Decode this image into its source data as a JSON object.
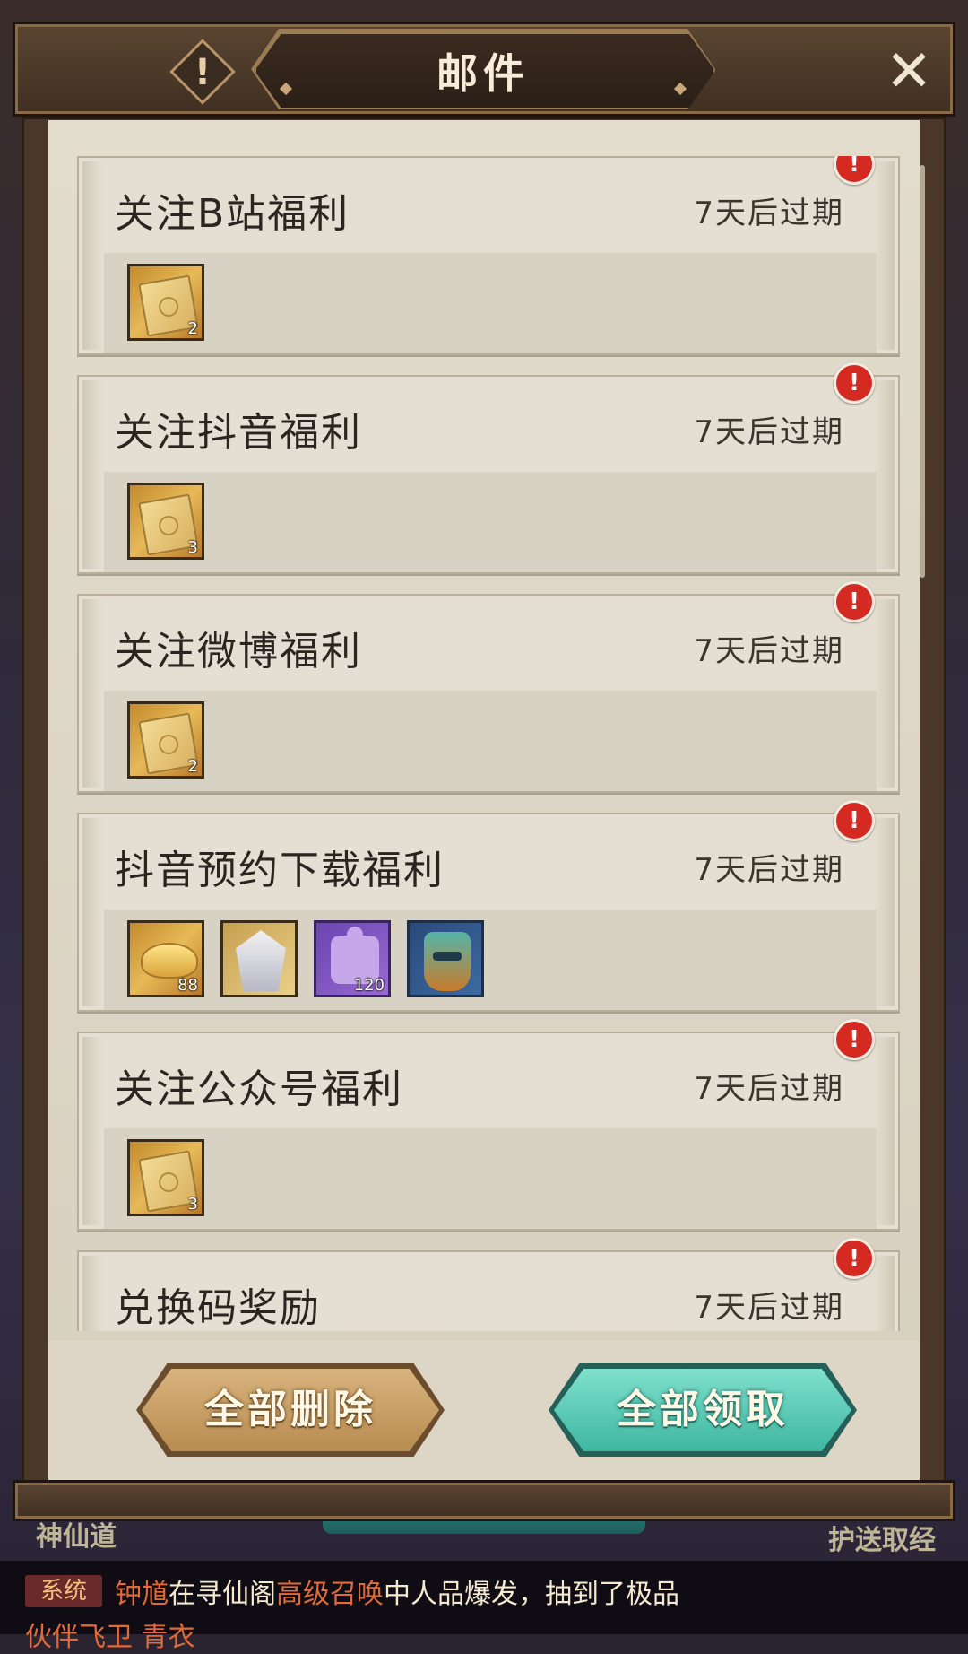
{
  "window": {
    "title": "邮件"
  },
  "mails": [
    {
      "title": "关注B站福利",
      "expiry": "7天后过期",
      "alert": "!",
      "rewards": [
        {
          "icon": "ticket",
          "count": "2"
        }
      ]
    },
    {
      "title": "关注抖音福利",
      "expiry": "7天后过期",
      "alert": "!",
      "rewards": [
        {
          "icon": "ticket",
          "count": "3"
        }
      ]
    },
    {
      "title": "关注微博福利",
      "expiry": "7天后过期",
      "alert": "!",
      "rewards": [
        {
          "icon": "ticket",
          "count": "2"
        }
      ]
    },
    {
      "title": "抖音预约下载福利",
      "expiry": "7天后过期",
      "alert": "!",
      "rewards": [
        {
          "icon": "gold-ingot",
          "count": "88"
        },
        {
          "icon": "hero-portrait",
          "count": ""
        },
        {
          "icon": "purple-puzzle",
          "count": "120"
        },
        {
          "icon": "mask-item",
          "count": ""
        }
      ]
    },
    {
      "title": "关注公众号福利",
      "expiry": "7天后过期",
      "alert": "!",
      "rewards": [
        {
          "icon": "ticket",
          "count": "3"
        }
      ]
    },
    {
      "title": "兑换码奖励",
      "expiry": "7天后过期",
      "alert": "!",
      "rewards": []
    }
  ],
  "buttons": {
    "delete_all": "全部删除",
    "claim_all": "全部领取"
  },
  "background": {
    "left_label": "神仙道",
    "right_label": "护送取经"
  },
  "chat": {
    "tag": "系统",
    "name": "钟馗",
    "text1": "在寻仙阁",
    "highlight": "高级召唤",
    "text2": "中人品爆发，抽到了极品",
    "line2": "伙伴飞卫 青衣"
  },
  "colors": {
    "alert_red": "#d42a22",
    "claim_teal": "#3fb7a0",
    "delete_tan": "#c9a067",
    "paper": "#e2dccd"
  }
}
